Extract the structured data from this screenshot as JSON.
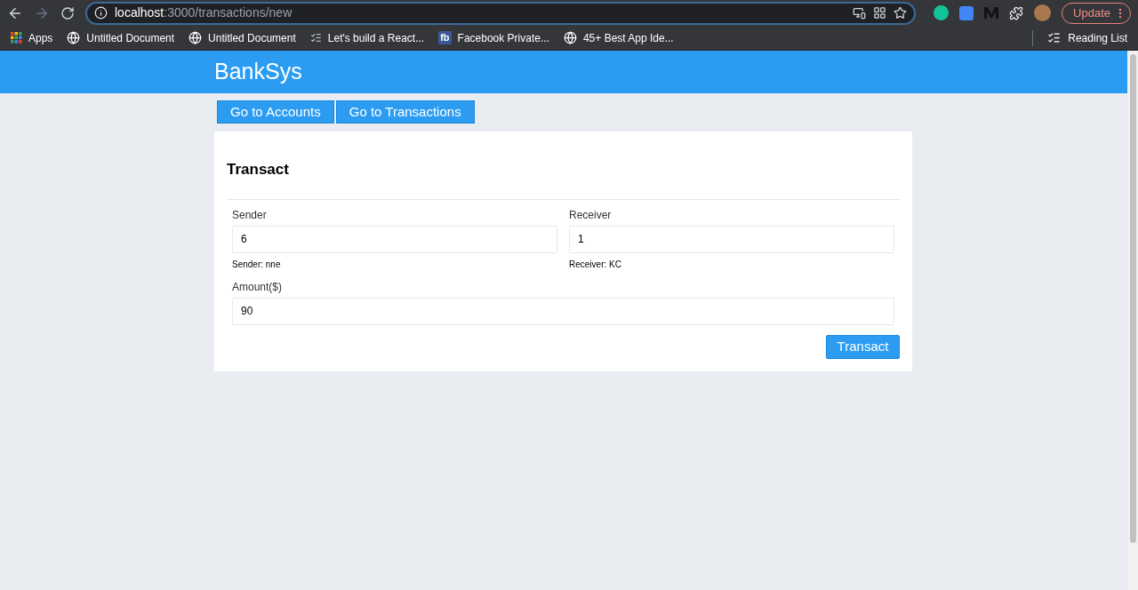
{
  "browser": {
    "url_host": "localhost",
    "url_path": ":3000/transactions/new",
    "update_label": "Update",
    "bookmarks": [
      {
        "kind": "apps",
        "label": "Apps"
      },
      {
        "kind": "globe",
        "label": "Untitled Document"
      },
      {
        "kind": "globe",
        "label": "Untitled Document"
      },
      {
        "kind": "lines",
        "label": "Let's build a React..."
      },
      {
        "kind": "fb",
        "badge": "fb",
        "label": "Facebook Private..."
      },
      {
        "kind": "globe",
        "label": "45+ Best App Ide..."
      }
    ],
    "reading_list": "Reading List"
  },
  "header": {
    "title": "BankSys"
  },
  "nav": [
    "Go to Accounts",
    "Go to Transactions"
  ],
  "form": {
    "title": "Transact",
    "fields": [
      {
        "label": "Sender",
        "value": "6",
        "hint": "Sender: nne"
      },
      {
        "label": "Receiver",
        "value": "1",
        "hint": "Receiver: KC"
      }
    ],
    "amount": {
      "label": "Amount($)",
      "value": "90"
    },
    "submit": "Transact"
  }
}
